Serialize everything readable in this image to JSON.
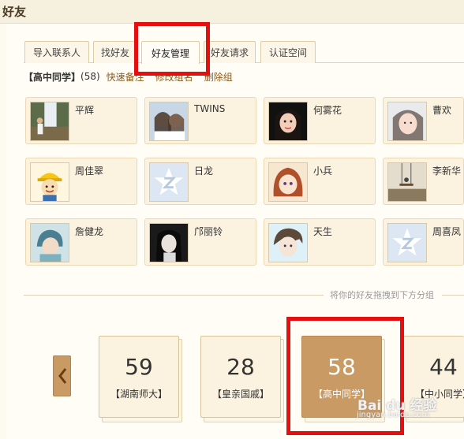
{
  "header": {
    "title": "好友"
  },
  "tabs": [
    {
      "label": "导入联系人"
    },
    {
      "label": "找好友"
    },
    {
      "label": "好友管理"
    },
    {
      "label": "好友请求"
    },
    {
      "label": "认证空间"
    }
  ],
  "group": {
    "name": "【高中同学】",
    "count": "(58)",
    "actions": [
      "快速备注",
      "修改组名",
      "删除组"
    ]
  },
  "friends": [
    {
      "name": "平辉",
      "avatar": "photo-waterfall"
    },
    {
      "name": "TWINS",
      "avatar": "photo-two-girls"
    },
    {
      "name": "何雾花",
      "avatar": "photo-girl-dark"
    },
    {
      "name": "曹欢",
      "avatar": "photo-girl-light"
    },
    {
      "name": "周佳翠",
      "avatar": "cartoon-worker"
    },
    {
      "name": "日龙",
      "avatar": "default-star"
    },
    {
      "name": "小兵",
      "avatar": "anime-girl"
    },
    {
      "name": "李新华",
      "avatar": "photo-swing"
    },
    {
      "name": "詹健龙",
      "avatar": "anime-boy"
    },
    {
      "name": "邝丽铃",
      "avatar": "photo-girl-bw"
    },
    {
      "name": "天生",
      "avatar": "anime-face"
    },
    {
      "name": "周喜凤",
      "avatar": "default-star"
    }
  ],
  "divider": {
    "text": "将你的好友拖拽到下方分组"
  },
  "groups_carousel": [
    {
      "count": "59",
      "label": "【湖南师大】"
    },
    {
      "count": "28",
      "label": "【皇亲国戚】"
    },
    {
      "count": "58",
      "label": "【高中同学】"
    },
    {
      "count": "44",
      "label": "【中小同学】"
    }
  ],
  "watermark": {
    "text": "Bai du 经验",
    "sub": "jingyan.baidu.com"
  },
  "colors": {
    "accent": "#c99a64",
    "highlight": "#e50f0f"
  }
}
